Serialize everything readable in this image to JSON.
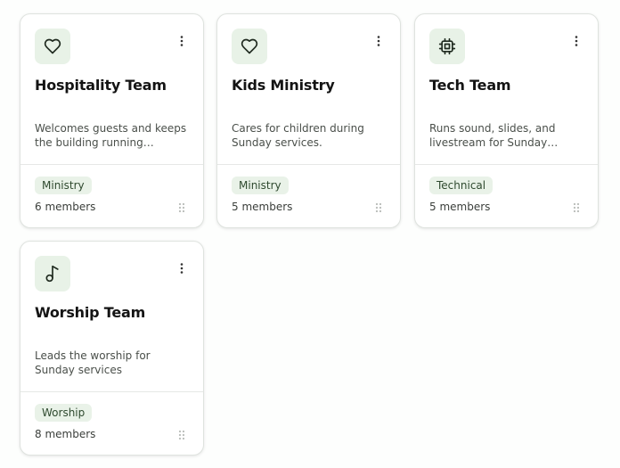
{
  "cards": [
    {
      "icon": "heart-icon",
      "title": "Hospitality Team",
      "description": "Welcomes guests and keeps the building running smoothly during services.",
      "tag": "Ministry",
      "members": "6 members"
    },
    {
      "icon": "heart-icon",
      "title": "Kids Ministry",
      "description": "Cares for children during Sunday services.",
      "tag": "Ministry",
      "members": "5 members"
    },
    {
      "icon": "chip-icon",
      "title": "Tech Team",
      "description": "Runs sound, slides, and livestream for Sunday services.",
      "tag": "Technical",
      "members": "5 members"
    },
    {
      "icon": "music-note-icon",
      "title": "Worship Team",
      "description": "Leads the worship for Sunday services",
      "tag": "Worship",
      "members": "8 members"
    }
  ],
  "colors": {
    "icon_bg": "#e8f2e7",
    "tag_bg": "#e9f2e8",
    "tag_text": "#2f4a2f",
    "card_border": "#dfe3df"
  }
}
